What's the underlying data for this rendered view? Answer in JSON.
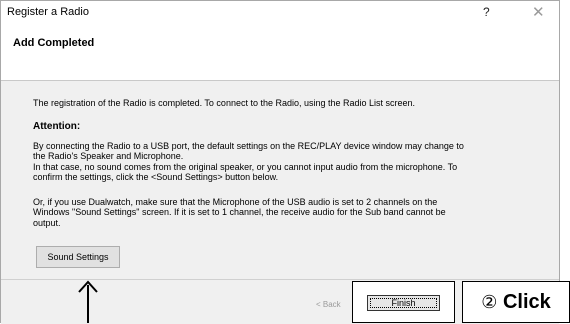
{
  "window": {
    "title": "Register a Radio",
    "help_glyph": "?",
    "close_glyph": "✕"
  },
  "header": {
    "title": "Add Completed"
  },
  "body": {
    "intro": "The registration of the Radio is completed. To connect to the Radio, using the Radio List screen.",
    "attention_heading": "Attention:",
    "para1_line1": "By connecting the Radio to a USB port, the default settings on the REC/PLAY device window may change to",
    "para1_line2": "the Radio's Speaker and Microphone.",
    "para1_line3": "In that case, no sound comes from the original speaker, or you cannot input audio from the microphone. To",
    "para1_line4": "confirm the settings, click the <Sound Settings> button below.",
    "para2_line1": "Or, if you use Dualwatch, make sure that the Microphone of the USB audio is set to 2 channels on the",
    "para2_line2": "Windows \"Sound Settings\" screen. If it is set to 1 channel, the receive audio for the Sub band cannot be",
    "para2_line3": "output.",
    "sound_settings_label": "Sound Settings"
  },
  "footer": {
    "back_label": "< Back",
    "finish_label": "Finish"
  },
  "annotation": {
    "step_number": "②",
    "step_text": "Click"
  }
}
